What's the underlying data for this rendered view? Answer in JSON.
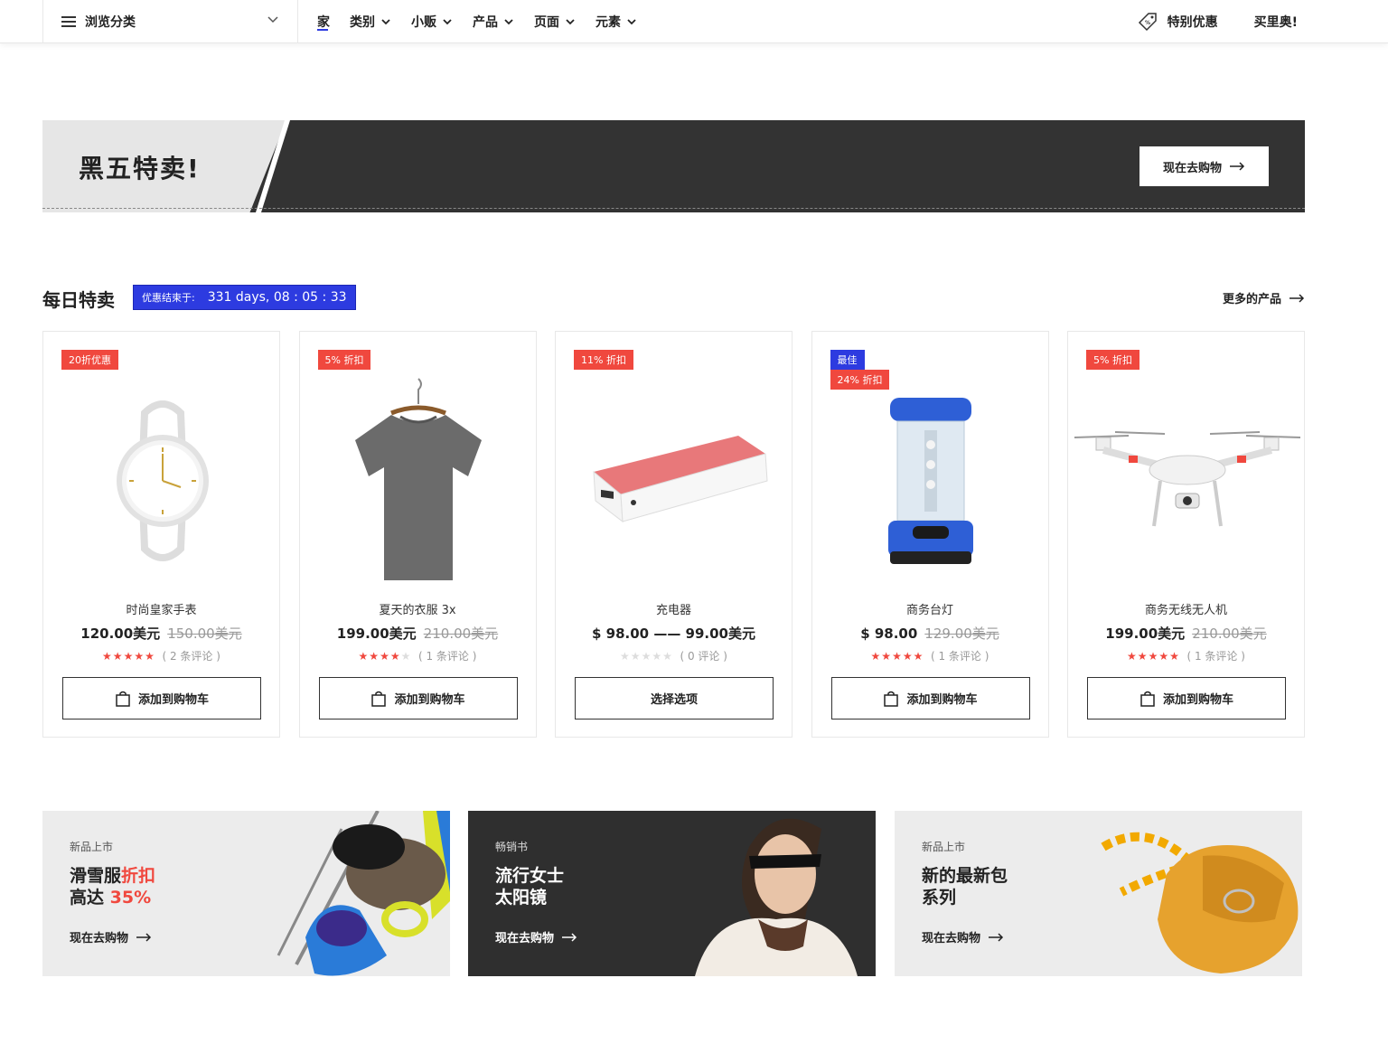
{
  "nav": {
    "browse_label": "浏览分类",
    "items": [
      "家",
      "类别",
      "小贩",
      "产品",
      "页面",
      "元素"
    ],
    "special_label": "特别优惠",
    "buy_label": "买里奥!"
  },
  "banner": {
    "title": "黑五特卖!",
    "button_label": "现在去购物"
  },
  "daily": {
    "title": "每日特卖",
    "countdown_label": "优惠结束于:",
    "countdown_time": "331 days, 08 : 05 : 33",
    "more_label": "更多的产品"
  },
  "products": [
    {
      "badges": [
        "20折优惠"
      ],
      "name": "时尚皇家手表",
      "price": "120.00美元",
      "old_price": "150.00美元",
      "stars": 5,
      "reviews": "( 2 条评论 )",
      "button": "添加到购物车",
      "image_icon": "watch"
    },
    {
      "badges": [
        "5% 折扣"
      ],
      "name": "夏天的衣服 3x",
      "price": "199.00美元",
      "old_price": "210.00美元",
      "stars": 4,
      "reviews": "( 1 条评论 )",
      "button": "添加到购物车",
      "image_icon": "tshirt"
    },
    {
      "badges": [
        "11% 折扣"
      ],
      "name": "充电器",
      "price": "$ 98.00 —— 99.00美元",
      "old_price": "",
      "stars": 0,
      "reviews": "( 0 评论 )",
      "button": "选择选项",
      "image_icon": "power-bank"
    },
    {
      "badges": [
        "最佳",
        "24% 折扣"
      ],
      "name": "商务台灯",
      "price": "$ 98.00",
      "old_price": "129.00美元",
      "stars": 5,
      "reviews": "( 1 条评论 )",
      "button": "添加到购物车",
      "image_icon": "lantern"
    },
    {
      "badges": [
        "5% 折扣"
      ],
      "name": "商务无线无人机",
      "price": "199.00美元",
      "old_price": "210.00美元",
      "stars": 5,
      "reviews": "( 1 条评论 )",
      "button": "添加到购物车",
      "image_icon": "drone"
    }
  ],
  "promos": [
    {
      "tag": "新品上市",
      "line1a": "滑雪服",
      "line1b": "折扣",
      "line2a": "高达 ",
      "line2b": "35%",
      "link": "现在去购物"
    },
    {
      "tag": "畅销书",
      "line1": "流行女士",
      "line2": "太阳镜",
      "link": "现在去购物"
    },
    {
      "tag": "新品上市",
      "line1": "新的最新包",
      "line2": "系列",
      "link": "现在去购物"
    }
  ],
  "colors": {
    "accent_red": "#f0483e",
    "accent_blue": "#2d3be0",
    "dark": "#333333"
  }
}
